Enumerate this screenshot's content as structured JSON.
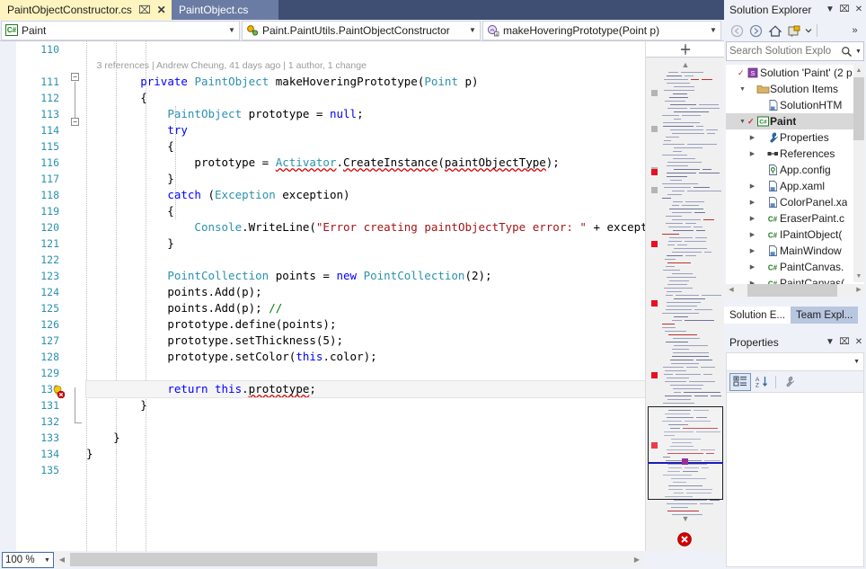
{
  "tabs": [
    {
      "label": "PaintObjectConstructor.cs",
      "active": true,
      "pin_icon": "pin-icon",
      "close_icon": "close-icon"
    },
    {
      "label": "PaintObject.cs",
      "active": false
    }
  ],
  "navbar": {
    "project_combo": {
      "value": "Paint",
      "icon": "csharp-project-icon",
      "arrow": "chevron-down-icon"
    },
    "class_combo": {
      "value": "Paint.PaintUtils.PaintObjectConstructor",
      "icon": "class-icon",
      "arrow": "chevron-down-icon"
    },
    "member_combo": {
      "value": "makeHoveringPrototype(Point p)",
      "icon": "private-method-icon",
      "arrow": "chevron-down-icon"
    }
  },
  "editor": {
    "codelens": "3 references | Andrew Cheung, 41 days ago | 1 author, 1 change",
    "first_line_number": 110,
    "current_line_number": 130,
    "lightbulb_icon": "lightbulb-error-icon",
    "lines": [
      {
        "n": 110,
        "text": ""
      },
      {
        "n": 111,
        "text": "        private PaintObject makeHoveringPrototype(Point p)"
      },
      {
        "n": 112,
        "text": "        {"
      },
      {
        "n": 113,
        "text": "            PaintObject prototype = null;"
      },
      {
        "n": 114,
        "text": "            try"
      },
      {
        "n": 115,
        "text": "            {"
      },
      {
        "n": 116,
        "text": "                prototype = Activator.CreateInstance(paintObjectType);"
      },
      {
        "n": 117,
        "text": "            }"
      },
      {
        "n": 118,
        "text": "            catch (Exception exception)"
      },
      {
        "n": 119,
        "text": "            {"
      },
      {
        "n": 120,
        "text": "                Console.WriteLine(\"Error creating paintObjectType error: \" + exception.Mes"
      },
      {
        "n": 121,
        "text": "            }"
      },
      {
        "n": 122,
        "text": ""
      },
      {
        "n": 123,
        "text": "            PointCollection points = new PointCollection(2);"
      },
      {
        "n": 124,
        "text": "            points.Add(p);"
      },
      {
        "n": 125,
        "text": "            points.Add(p); //"
      },
      {
        "n": 126,
        "text": "            prototype.define(points);"
      },
      {
        "n": 127,
        "text": "            prototype.setThickness(5);"
      },
      {
        "n": 128,
        "text": "            prototype.setColor(this.color);"
      },
      {
        "n": 129,
        "text": ""
      },
      {
        "n": 130,
        "text": "            return this.prototype;"
      },
      {
        "n": 131,
        "text": "        }"
      },
      {
        "n": 132,
        "text": ""
      },
      {
        "n": 133,
        "text": "    }"
      },
      {
        "n": 134,
        "text": "}"
      },
      {
        "n": 135,
        "text": ""
      }
    ]
  },
  "scrollbar_map": {
    "split_icon": "split-view-icon",
    "up_arrow_icon": "chevron-up-icon",
    "down_arrow_icon": "chevron-down-icon",
    "error_icon": "error-circle-icon"
  },
  "bottom": {
    "zoom_level": "100 %",
    "zoom_arrow": "chevron-down-icon",
    "hscroll_left_icon": "chevron-left-icon",
    "hscroll_right_icon": "chevron-right-icon"
  },
  "solution_explorer": {
    "title": "Solution Explorer",
    "dropdown_icon": "chevron-down-icon",
    "pin_icon": "pin-icon",
    "close_icon": "close-icon",
    "toolbar": [
      {
        "name": "back-icon",
        "glyph": "←"
      },
      {
        "name": "forward-icon",
        "glyph": "→"
      },
      {
        "name": "home-icon",
        "glyph": "⌂"
      },
      {
        "name": "sync-with-active-document-icon",
        "glyph": "⧉"
      },
      {
        "name": "chevron-down-icon",
        "glyph": "▾"
      },
      {
        "name": "overflow-icon",
        "glyph": "»"
      }
    ],
    "search": {
      "placeholder": "Search Solution Explo",
      "value": "",
      "icon": "search-icon",
      "arrow": "chevron-down-icon"
    },
    "tree": [
      {
        "label": "Solution 'Paint' (2 p",
        "indent": 0,
        "expander": "",
        "tick": true,
        "icon": "solution-icon",
        "bold": false,
        "selected": false
      },
      {
        "label": "Solution Items",
        "indent": 1,
        "expander": "▴",
        "tick": false,
        "icon": "folder-icon",
        "bold": false,
        "selected": false
      },
      {
        "label": "SolutionHTM",
        "indent": 2,
        "expander": "",
        "tick": false,
        "icon": "file-add-icon",
        "bold": false,
        "selected": false
      },
      {
        "label": "Paint",
        "indent": 1,
        "expander": "▴",
        "tick": true,
        "icon": "csharp-project-icon",
        "bold": true,
        "selected": true
      },
      {
        "label": "Properties",
        "indent": 2,
        "expander": "▸",
        "tick": false,
        "icon": "wrench-icon",
        "bold": false,
        "selected": false
      },
      {
        "label": "References",
        "indent": 2,
        "expander": "▸",
        "tick": false,
        "icon": "references-icon",
        "bold": false,
        "selected": false
      },
      {
        "label": "App.config",
        "indent": 2,
        "expander": "",
        "tick": false,
        "icon": "config-file-icon",
        "bold": false,
        "selected": false
      },
      {
        "label": "App.xaml",
        "indent": 2,
        "expander": "▸",
        "tick": false,
        "icon": "xaml-file-icon",
        "bold": false,
        "selected": false
      },
      {
        "label": "ColorPanel.xa",
        "indent": 2,
        "expander": "▸",
        "tick": false,
        "icon": "xaml-file-icon",
        "bold": false,
        "selected": false
      },
      {
        "label": "EraserPaint.c",
        "indent": 2,
        "expander": "▸",
        "tick": false,
        "icon": "csharp-file-icon",
        "bold": false,
        "selected": false
      },
      {
        "label": "IPaintObject(",
        "indent": 2,
        "expander": "▸",
        "tick": false,
        "icon": "csharp-file-icon",
        "bold": false,
        "selected": false
      },
      {
        "label": "MainWindow",
        "indent": 2,
        "expander": "▸",
        "tick": false,
        "icon": "xaml-file-icon",
        "bold": false,
        "selected": false
      },
      {
        "label": "PaintCanvas.",
        "indent": 2,
        "expander": "▸",
        "tick": false,
        "icon": "csharp-file-icon",
        "bold": false,
        "selected": false
      },
      {
        "label": "PaintCanvas(",
        "indent": 2,
        "expander": "▸",
        "tick": false,
        "icon": "csharp-file-icon",
        "bold": false,
        "selected": false
      }
    ],
    "dock_tabs": [
      {
        "label": "Solution E...",
        "active": true
      },
      {
        "label": "Team Expl...",
        "active": false
      }
    ]
  },
  "properties_window": {
    "title": "Properties",
    "dropdown_icon": "chevron-down-icon",
    "pin_icon": "pin-icon",
    "close_icon": "close-icon",
    "object_combo": {
      "value": "",
      "arrow": "chevron-down-icon"
    },
    "toolbar": [
      {
        "name": "categorized-view-icon",
        "glyph": "☷"
      },
      {
        "name": "alphabetical-view-icon",
        "glyph": "A↓"
      },
      {
        "name": "property-pages-icon",
        "glyph": "ὒ7"
      }
    ]
  },
  "colors": {
    "tab_active_bg": "#fdf4bf",
    "tab_inactive_bg": "#6b7ca4",
    "tab_strip_bg": "#3f4f73",
    "chrome_bg": "#eef1f7",
    "keyword": "#0000ff",
    "type": "#2b91af",
    "string": "#a31515",
    "comment": "#008000",
    "linenumber": "#2b91af",
    "error_red": "#e81123",
    "codelens_gray": "#9b9b9b"
  }
}
